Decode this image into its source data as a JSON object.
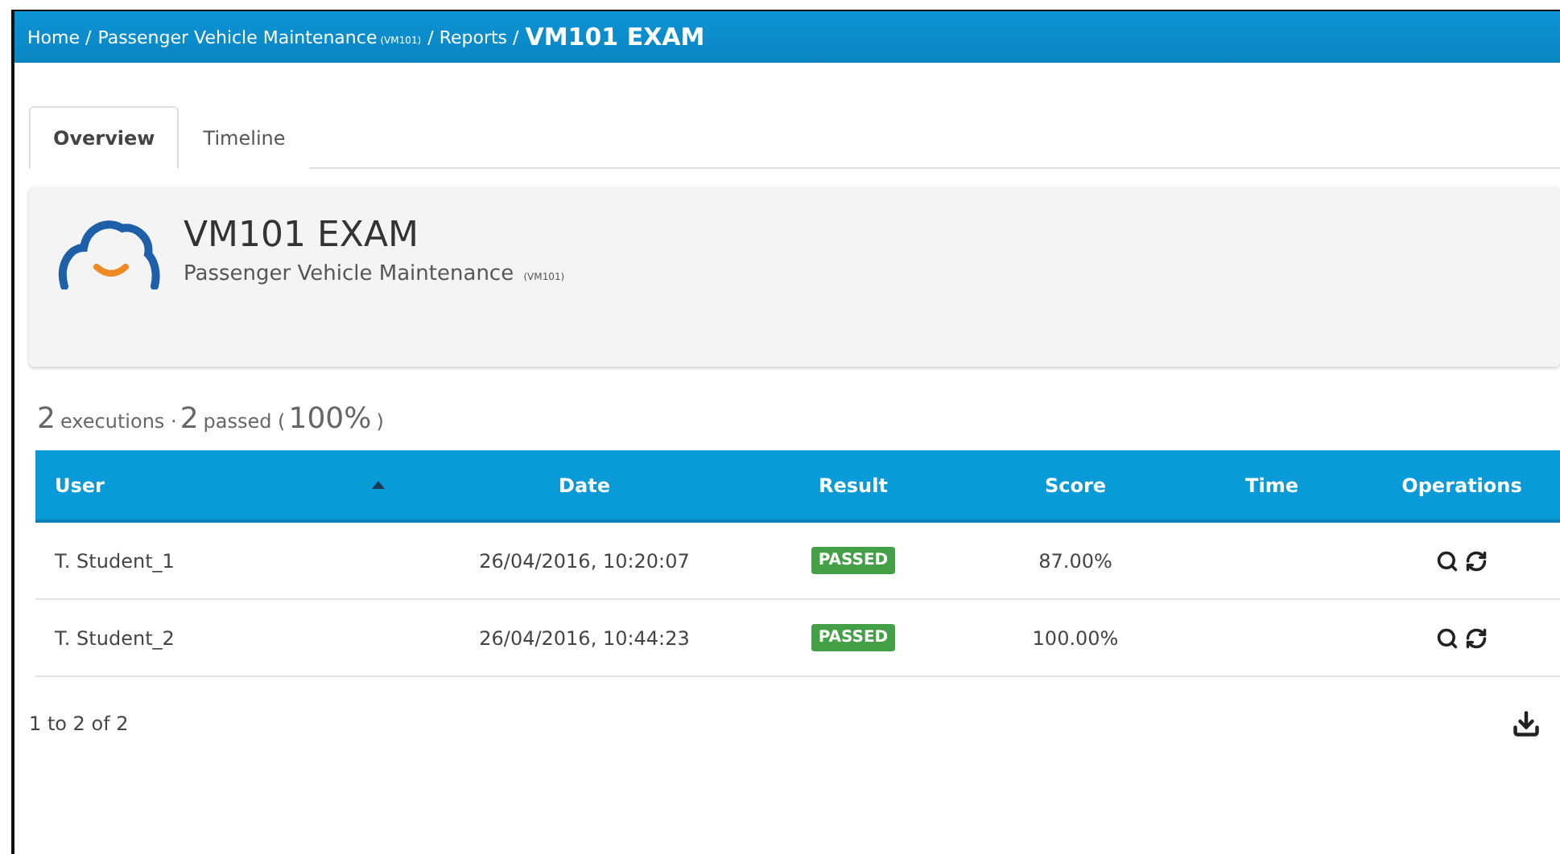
{
  "breadcrumb": [
    {
      "text": "Home /"
    },
    {
      "text": "Passenger Vehicle Maintenance",
      "code": "(VM101)"
    },
    {
      "text": "/ Reports /"
    },
    {
      "text": "VM101 EXAM",
      "current": true
    }
  ],
  "tabs": [
    {
      "label": "Overview",
      "selected": true
    },
    {
      "label": "Timeline",
      "selected": false
    }
  ],
  "header": {
    "title": "VM101 EXAM",
    "subtitle": "Passenger Vehicle Maintenance",
    "code": "(VM101)"
  },
  "summary": [
    {
      "text": "2",
      "big": true
    },
    {
      "text": "executions ·",
      "big": false
    },
    {
      "text": "2",
      "big": true
    },
    {
      "text": "passed (",
      "big": false
    },
    {
      "text": "100%",
      "big": true
    },
    {
      "text": ")",
      "big": false
    }
  ],
  "table": {
    "columns": [
      {
        "label": "User",
        "sorted": true
      },
      {
        "label": "Date",
        "sorted": false
      },
      {
        "label": "Result",
        "sorted": false
      },
      {
        "label": "Score",
        "sorted": false
      },
      {
        "label": "Time",
        "sorted": false
      },
      {
        "label": "Operations",
        "sorted": false
      }
    ],
    "rows": [
      {
        "user": "T. Student_1",
        "date": "26/04/2016, 10:20:07",
        "result": "PASSED",
        "passed": true,
        "score": "87.00%"
      },
      {
        "user": "T. Student_2",
        "date": "26/04/2016, 10:44:23",
        "result": "PASSED",
        "passed": true,
        "score": "100.00%"
      }
    ]
  },
  "pagination": "1 to 2 of 2"
}
